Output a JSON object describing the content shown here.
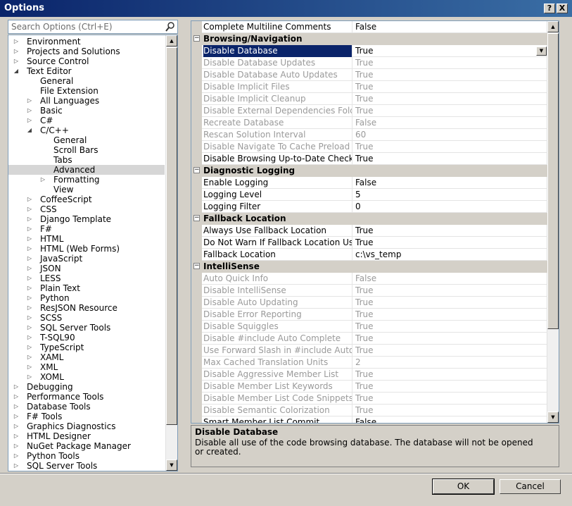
{
  "window": {
    "title": "Options",
    "help_label": "?",
    "close_label": "X"
  },
  "search": {
    "placeholder": "Search Options (Ctrl+E)"
  },
  "tree": [
    {
      "label": "Environment",
      "level": 0,
      "state": "collapsed"
    },
    {
      "label": "Projects and Solutions",
      "level": 0,
      "state": "collapsed"
    },
    {
      "label": "Source Control",
      "level": 0,
      "state": "collapsed"
    },
    {
      "label": "Text Editor",
      "level": 0,
      "state": "expanded"
    },
    {
      "label": "General",
      "level": 1,
      "state": "leaf"
    },
    {
      "label": "File Extension",
      "level": 1,
      "state": "leaf"
    },
    {
      "label": "All Languages",
      "level": 1,
      "state": "collapsed"
    },
    {
      "label": "Basic",
      "level": 1,
      "state": "collapsed"
    },
    {
      "label": "C#",
      "level": 1,
      "state": "collapsed"
    },
    {
      "label": "C/C++",
      "level": 1,
      "state": "expanded"
    },
    {
      "label": "General",
      "level": 2,
      "state": "leaf"
    },
    {
      "label": "Scroll Bars",
      "level": 2,
      "state": "leaf"
    },
    {
      "label": "Tabs",
      "level": 2,
      "state": "leaf"
    },
    {
      "label": "Advanced",
      "level": 2,
      "state": "leaf",
      "selected": true
    },
    {
      "label": "Formatting",
      "level": 2,
      "state": "collapsed"
    },
    {
      "label": "View",
      "level": 2,
      "state": "leaf"
    },
    {
      "label": "CoffeeScript",
      "level": 1,
      "state": "collapsed"
    },
    {
      "label": "CSS",
      "level": 1,
      "state": "collapsed"
    },
    {
      "label": "Django Template",
      "level": 1,
      "state": "collapsed"
    },
    {
      "label": "F#",
      "level": 1,
      "state": "collapsed"
    },
    {
      "label": "HTML",
      "level": 1,
      "state": "collapsed"
    },
    {
      "label": "HTML (Web Forms)",
      "level": 1,
      "state": "collapsed"
    },
    {
      "label": "JavaScript",
      "level": 1,
      "state": "collapsed"
    },
    {
      "label": "JSON",
      "level": 1,
      "state": "collapsed"
    },
    {
      "label": "LESS",
      "level": 1,
      "state": "collapsed"
    },
    {
      "label": "Plain Text",
      "level": 1,
      "state": "collapsed"
    },
    {
      "label": "Python",
      "level": 1,
      "state": "collapsed"
    },
    {
      "label": "ResJSON Resource",
      "level": 1,
      "state": "collapsed"
    },
    {
      "label": "SCSS",
      "level": 1,
      "state": "collapsed"
    },
    {
      "label": "SQL Server Tools",
      "level": 1,
      "state": "collapsed"
    },
    {
      "label": "T-SQL90",
      "level": 1,
      "state": "collapsed"
    },
    {
      "label": "TypeScript",
      "level": 1,
      "state": "collapsed"
    },
    {
      "label": "XAML",
      "level": 1,
      "state": "collapsed"
    },
    {
      "label": "XML",
      "level": 1,
      "state": "collapsed"
    },
    {
      "label": "XOML",
      "level": 1,
      "state": "collapsed"
    },
    {
      "label": "Debugging",
      "level": 0,
      "state": "collapsed"
    },
    {
      "label": "Performance Tools",
      "level": 0,
      "state": "collapsed"
    },
    {
      "label": "Database Tools",
      "level": 0,
      "state": "collapsed"
    },
    {
      "label": "F# Tools",
      "level": 0,
      "state": "collapsed"
    },
    {
      "label": "Graphics Diagnostics",
      "level": 0,
      "state": "collapsed"
    },
    {
      "label": "HTML Designer",
      "level": 0,
      "state": "collapsed"
    },
    {
      "label": "NuGet Package Manager",
      "level": 0,
      "state": "collapsed"
    },
    {
      "label": "Python Tools",
      "level": 0,
      "state": "collapsed"
    },
    {
      "label": "SQL Server Tools",
      "level": 0,
      "state": "collapsed"
    }
  ],
  "grid": [
    {
      "kind": "prop",
      "name": "Complete Multiline Comments",
      "value": "False"
    },
    {
      "kind": "cat",
      "name": "Browsing/Navigation"
    },
    {
      "kind": "prop",
      "name": "Disable Database",
      "value": "True",
      "selected": true
    },
    {
      "kind": "prop",
      "name": "Disable Database Updates",
      "value": "True",
      "disabled": true
    },
    {
      "kind": "prop",
      "name": "Disable Database Auto Updates",
      "value": "True",
      "disabled": true
    },
    {
      "kind": "prop",
      "name": "Disable Implicit Files",
      "value": "True",
      "disabled": true
    },
    {
      "kind": "prop",
      "name": "Disable Implicit Cleanup",
      "value": "True",
      "disabled": true
    },
    {
      "kind": "prop",
      "name": "Disable External Dependencies Folders",
      "value": "True",
      "disabled": true
    },
    {
      "kind": "prop",
      "name": "Recreate Database",
      "value": "False",
      "disabled": true
    },
    {
      "kind": "prop",
      "name": "Rescan Solution Interval",
      "value": "60",
      "disabled": true
    },
    {
      "kind": "prop",
      "name": "Disable Navigate To Cache Preload",
      "value": "True",
      "disabled": true
    },
    {
      "kind": "prop",
      "name": "Disable Browsing Up-to-Date Check",
      "value": "True"
    },
    {
      "kind": "cat",
      "name": "Diagnostic Logging"
    },
    {
      "kind": "prop",
      "name": "Enable Logging",
      "value": "False"
    },
    {
      "kind": "prop",
      "name": "Logging Level",
      "value": "5"
    },
    {
      "kind": "prop",
      "name": "Logging Filter",
      "value": "0"
    },
    {
      "kind": "cat",
      "name": "Fallback Location"
    },
    {
      "kind": "prop",
      "name": "Always Use Fallback Location",
      "value": "True"
    },
    {
      "kind": "prop",
      "name": "Do Not Warn If Fallback Location Used",
      "value": "True"
    },
    {
      "kind": "prop",
      "name": "Fallback Location",
      "value": "c:\\vs_temp"
    },
    {
      "kind": "cat",
      "name": "IntelliSense"
    },
    {
      "kind": "prop",
      "name": "Auto Quick Info",
      "value": "False",
      "disabled": true
    },
    {
      "kind": "prop",
      "name": "Disable IntelliSense",
      "value": "True",
      "disabled": true
    },
    {
      "kind": "prop",
      "name": "Disable Auto Updating",
      "value": "True",
      "disabled": true
    },
    {
      "kind": "prop",
      "name": "Disable Error Reporting",
      "value": "True",
      "disabled": true
    },
    {
      "kind": "prop",
      "name": "Disable Squiggles",
      "value": "True",
      "disabled": true
    },
    {
      "kind": "prop",
      "name": "Disable #include Auto Complete",
      "value": "True",
      "disabled": true
    },
    {
      "kind": "prop",
      "name": "Use Forward Slash in #include Auto Complete",
      "value": "True",
      "disabled": true
    },
    {
      "kind": "prop",
      "name": "Max Cached Translation Units",
      "value": "2",
      "disabled": true
    },
    {
      "kind": "prop",
      "name": "Disable Aggressive Member List",
      "value": "True",
      "disabled": true
    },
    {
      "kind": "prop",
      "name": "Disable Member List Keywords",
      "value": "True",
      "disabled": true
    },
    {
      "kind": "prop",
      "name": "Disable Member List Code Snippets",
      "value": "True",
      "disabled": true
    },
    {
      "kind": "prop",
      "name": "Disable Semantic Colorization",
      "value": "True",
      "disabled": true
    },
    {
      "kind": "prop",
      "name": "Smart Member List Commit",
      "value": "False"
    }
  ],
  "description": {
    "title": "Disable Database",
    "text": "Disable all use of the code browsing database.  The database will not be opened or created."
  },
  "buttons": {
    "ok": "OK",
    "cancel": "Cancel"
  },
  "colors": {
    "title_start": "#0a246a",
    "title_end": "#3a6ea5",
    "selection": "#0a246a",
    "disabled_text": "#9a9a9a"
  }
}
